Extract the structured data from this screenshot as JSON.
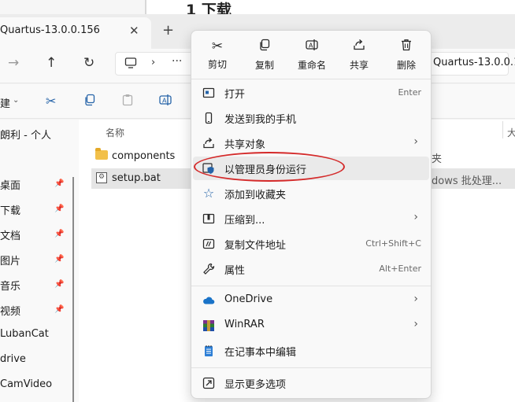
{
  "document": {
    "heading": "1 下载"
  },
  "browser": {
    "tab_title": "Quartus-13.0.0.156",
    "tab_close": "✕",
    "new_tab": "+"
  },
  "nav": {
    "forward": "→",
    "up": "↑",
    "refresh": "↻",
    "address_chevron": "›",
    "address_more": "···",
    "address_path": "Quartus-13.0.0.1"
  },
  "toolbar": {
    "new_label": "建"
  },
  "sidebar": {
    "items": [
      {
        "label": "朗利 - 个人",
        "pinned": false
      },
      {
        "label": "桌面",
        "pinned": true
      },
      {
        "label": "下载",
        "pinned": true
      },
      {
        "label": "文档",
        "pinned": true
      },
      {
        "label": "图片",
        "pinned": true
      },
      {
        "label": "音乐",
        "pinned": true
      },
      {
        "label": "视频",
        "pinned": true
      },
      {
        "label": "LubanCat",
        "pinned": false
      },
      {
        "label": "drive",
        "pinned": false
      },
      {
        "label": "CamVideo",
        "pinned": false
      }
    ]
  },
  "files": {
    "col_name": "名称",
    "col_size": "大",
    "rows": [
      {
        "name": "components",
        "type": "夹"
      },
      {
        "name": "setup.bat",
        "type": "dows 批处理..."
      }
    ]
  },
  "context_menu": {
    "quick_actions": [
      {
        "label": "剪切",
        "icon": "cut-icon"
      },
      {
        "label": "复制",
        "icon": "copy-icon"
      },
      {
        "label": "重命名",
        "icon": "rename-icon"
      },
      {
        "label": "共享",
        "icon": "share-icon"
      },
      {
        "label": "删除",
        "icon": "delete-icon"
      }
    ],
    "items": [
      {
        "label": "打开",
        "shortcut": "Enter",
        "icon": "open-icon"
      },
      {
        "label": "发送到我的手机",
        "shortcut": "",
        "icon": "phone-icon"
      },
      {
        "label": "共享对象",
        "shortcut": "",
        "icon": "share-with-icon",
        "submenu": true
      },
      {
        "label": "以管理员身份运行",
        "shortcut": "",
        "icon": "shield-icon",
        "highlighted": true
      },
      {
        "label": "添加到收藏夹",
        "shortcut": "",
        "icon": "star-icon"
      },
      {
        "label": "压缩到...",
        "shortcut": "",
        "icon": "zip-icon",
        "submenu": true
      },
      {
        "label": "复制文件地址",
        "shortcut": "Ctrl+Shift+C",
        "icon": "copy-path-icon"
      },
      {
        "label": "属性",
        "shortcut": "Alt+Enter",
        "icon": "wrench-icon"
      },
      {
        "label": "OneDrive",
        "shortcut": "",
        "icon": "cloud-icon",
        "submenu": true
      },
      {
        "label": "WinRAR",
        "shortcut": "",
        "icon": "winrar-icon",
        "submenu": true
      },
      {
        "label": "在记事本中编辑",
        "shortcut": "",
        "icon": "notepad-icon"
      },
      {
        "label": "显示更多选项",
        "shortcut": "",
        "icon": "more-options-icon"
      }
    ],
    "arrow": "›"
  },
  "colors": {
    "accent": "#2563a8",
    "annotation_red": "#d42a2a",
    "folder_yellow": "#f2c04a",
    "onedrive_blue": "#1a73c8"
  }
}
